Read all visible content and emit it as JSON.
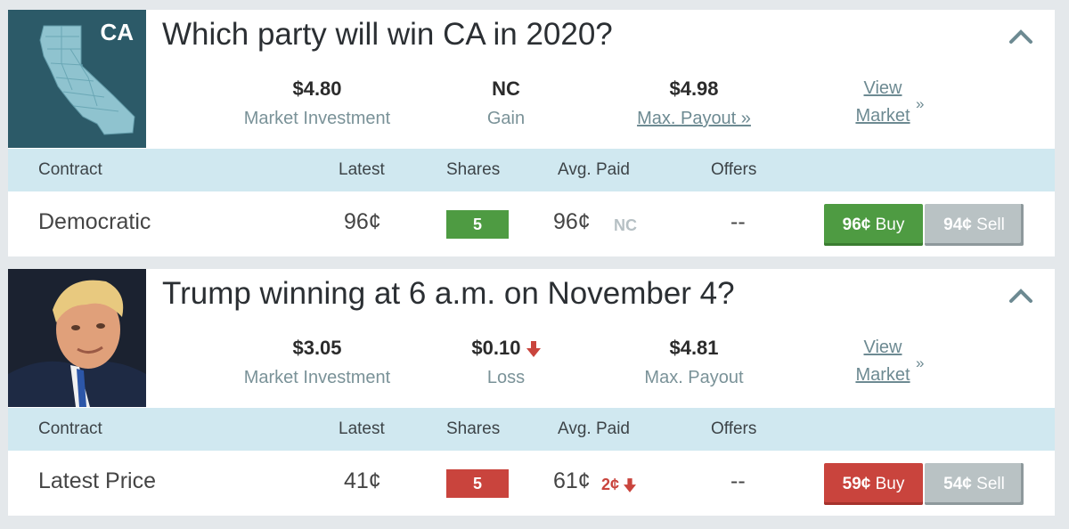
{
  "colors": {
    "header_row_bg": "#d0e8f0",
    "green": "#4e9b42",
    "red": "#c9443d",
    "sell_gray": "#b9c2c4",
    "link": "#6d8a92"
  },
  "markets": [
    {
      "thumb_text": "CA",
      "title": "Which party will win CA in 2020?",
      "stats": {
        "investment_value": "$4.80",
        "investment_label": "Market Investment",
        "gain_value": "NC",
        "gain_label": "Gain",
        "payout_value": "$4.98",
        "payout_label": "Max. Payout »"
      },
      "view_market_line1": "View",
      "view_market_line2": "Market",
      "view_market_chevron": "»",
      "headers": {
        "contract": "Contract",
        "latest": "Latest",
        "shares": "Shares",
        "avg_paid": "Avg. Paid",
        "offers": "Offers"
      },
      "row": {
        "contract": "Democratic",
        "latest": "96¢",
        "shares": "5",
        "avg_paid": "96¢",
        "avg_change": "NC",
        "offers": "--",
        "buy_price": "96¢",
        "buy_label": "Buy",
        "sell_price": "94¢",
        "sell_label": "Sell"
      }
    },
    {
      "title": "Trump winning at 6 a.m. on November 4?",
      "stats": {
        "investment_value": "$3.05",
        "investment_label": "Market Investment",
        "gain_value": "$0.10",
        "gain_label": "Loss",
        "payout_value": "$4.81",
        "payout_label": "Max. Payout"
      },
      "view_market_line1": "View",
      "view_market_line2": "Market",
      "view_market_chevron": "»",
      "headers": {
        "contract": "Contract",
        "latest": "Latest",
        "shares": "Shares",
        "avg_paid": "Avg. Paid",
        "offers": "Offers"
      },
      "row": {
        "contract": "Latest Price",
        "latest": "41¢",
        "shares": "5",
        "avg_paid": "61¢",
        "avg_change": "2¢",
        "offers": "--",
        "buy_price": "59¢",
        "buy_label": "Buy",
        "sell_price": "54¢",
        "sell_label": "Sell"
      }
    }
  ]
}
